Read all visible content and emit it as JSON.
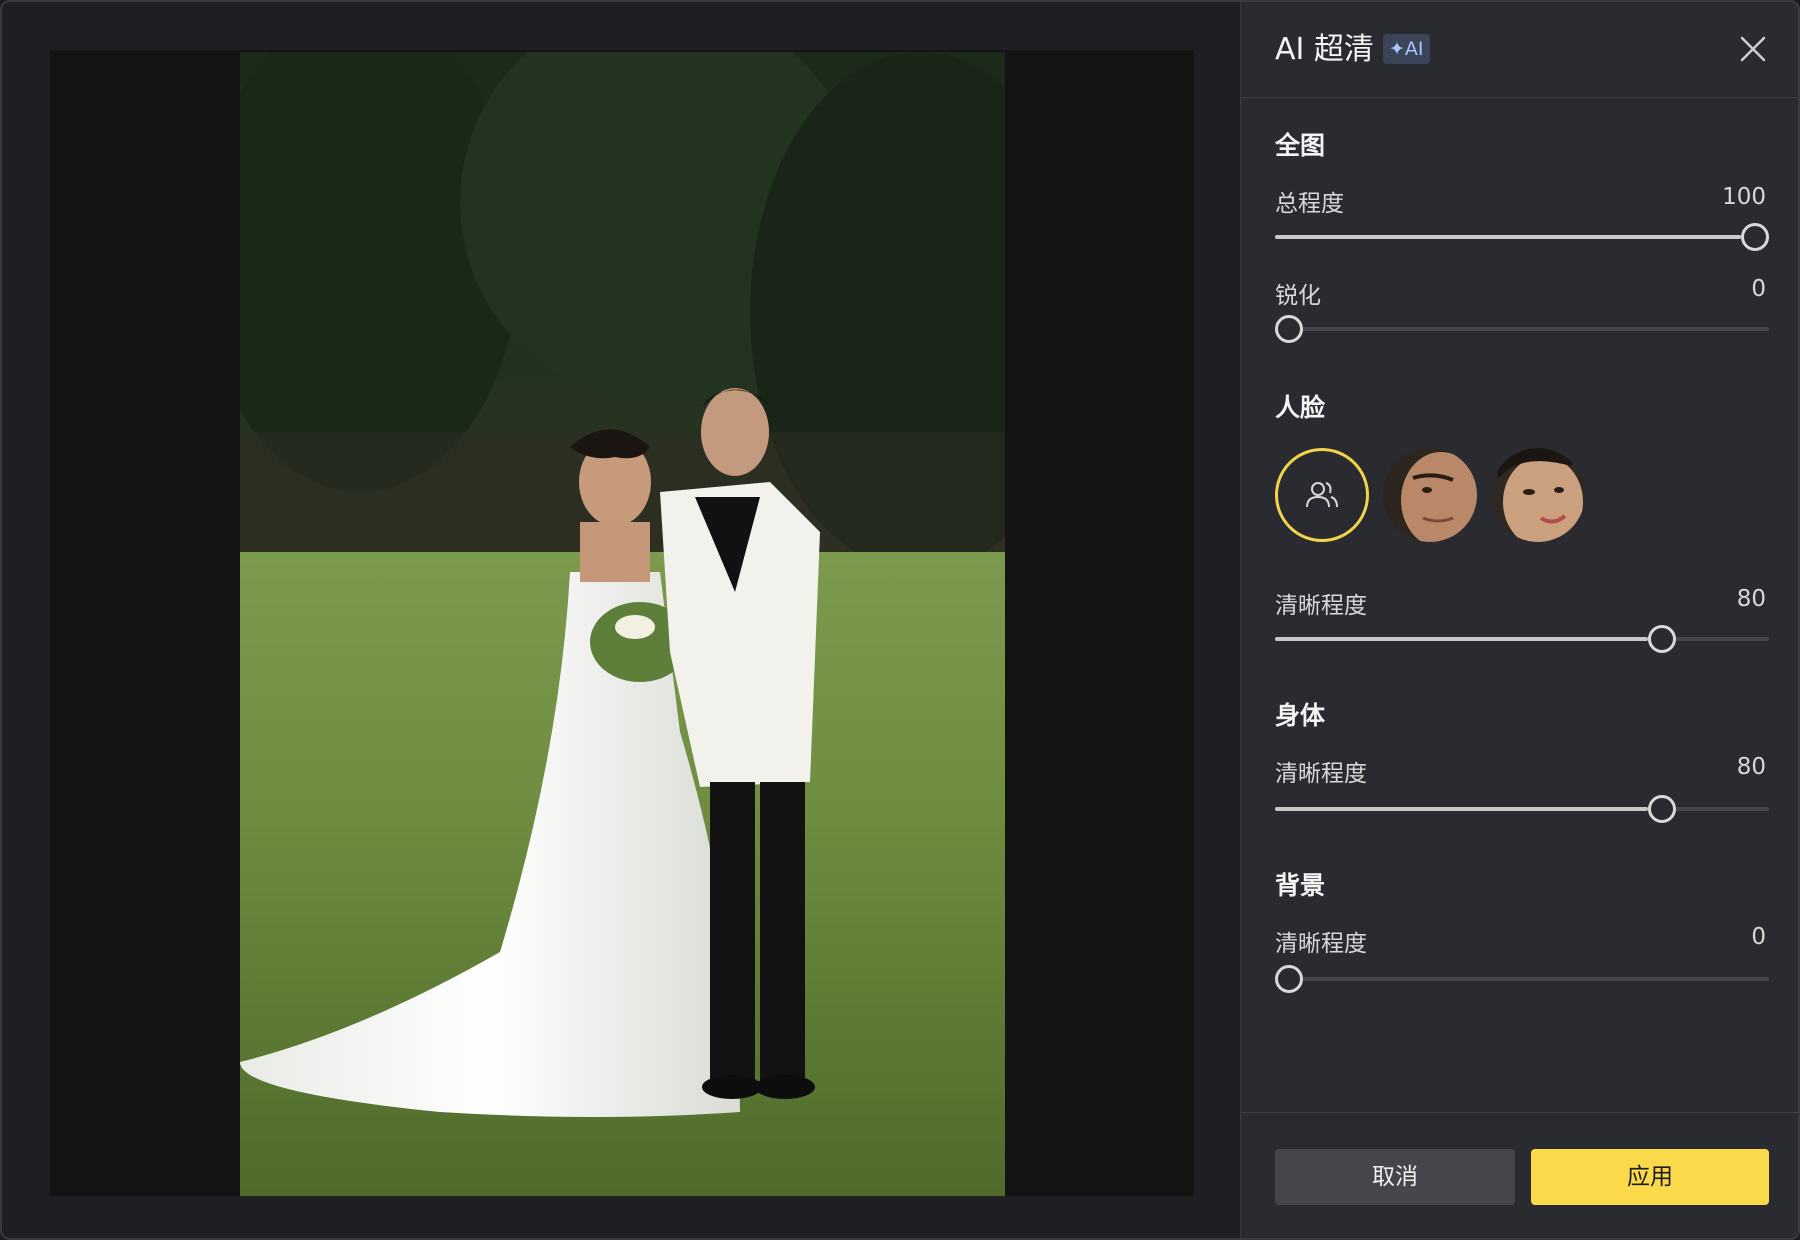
{
  "panel": {
    "title": "AI 超清",
    "badge": "✦AI"
  },
  "sections": {
    "whole": {
      "title": "全图",
      "overall_label": "总程度",
      "overall_value": "100",
      "overall_level": 1.0,
      "sharpen_label": "锐化",
      "sharpen_value": "0",
      "sharpen_level": 0.0
    },
    "face": {
      "title": "人脸",
      "faces": [
        "all-faces",
        "groom-face",
        "bride-face"
      ],
      "clarity_label": "清晰程度",
      "clarity_value": "80",
      "clarity_level": 0.8
    },
    "body": {
      "title": "身体",
      "clarity_label": "清晰程度",
      "clarity_value": "80",
      "clarity_level": 0.8
    },
    "background": {
      "title": "背景",
      "clarity_label": "清晰程度",
      "clarity_value": "0",
      "clarity_level": 0.0
    }
  },
  "footer": {
    "cancel_label": "取消",
    "apply_label": "应用"
  },
  "colors": {
    "accent": "#fad94a",
    "panel_bg": "#2a2b30",
    "canvas_bg": "#141414"
  },
  "icons": {
    "close": "close-icon",
    "all_faces": "people-icon"
  }
}
